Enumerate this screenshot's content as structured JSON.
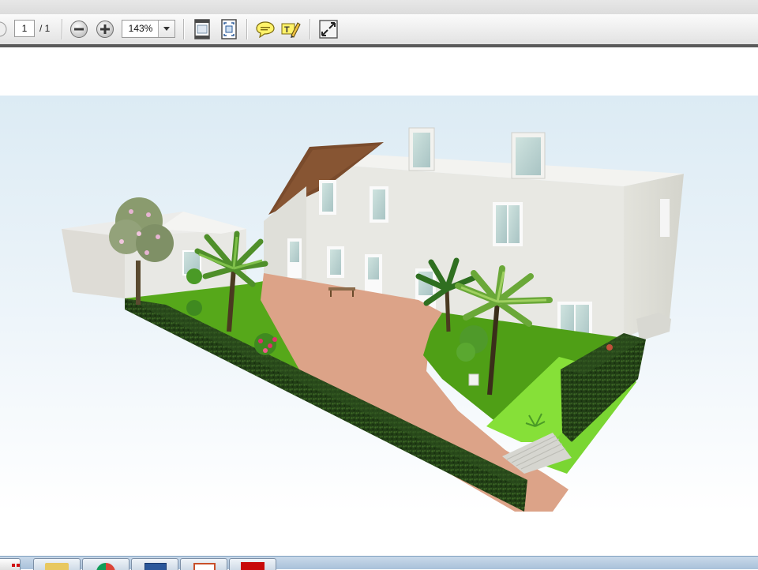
{
  "toolbar": {
    "page_current": "1",
    "page_total": "/ 1",
    "zoom_value": "143%"
  },
  "document": {
    "view": "3d-garden-house-render"
  },
  "icons": {
    "nav": "page-arrow-icon",
    "zoom_out": "zoom-out-icon",
    "zoom_in": "zoom-in-icon",
    "zoom_dropdown": "chevron-down-icon",
    "fit_page": "fit-page-icon",
    "fit_width": "fit-width-icon",
    "comment": "comment-icon",
    "highlight": "highlight-text-icon",
    "expand": "expand-icon"
  },
  "taskbar": {
    "items": [
      "start-icon",
      "folder-icon",
      "chrome-icon",
      "word-icon",
      "powerpoint-icon",
      "pdf-icon"
    ]
  },
  "colors": {
    "toolbar_border": "#5a5a5a",
    "lawn": "#56a81a",
    "lawn_light": "#86e038",
    "path": "#dca388",
    "hedge": "#1f3a14",
    "wall": "#e6e6e1",
    "sky_top": "#dcebf4"
  }
}
